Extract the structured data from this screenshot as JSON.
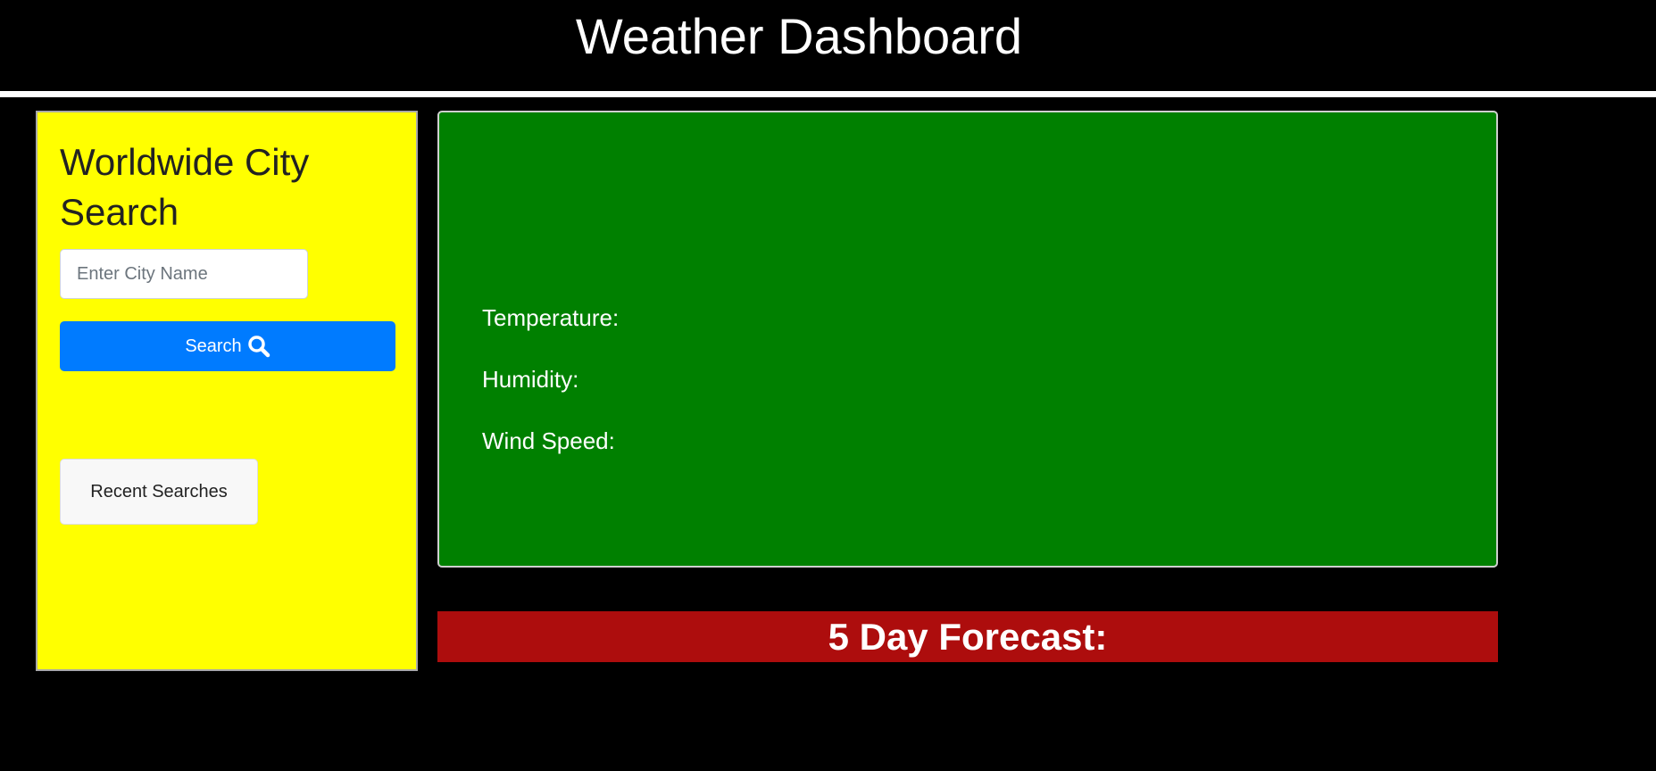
{
  "header": {
    "title": "Weather Dashboard"
  },
  "sidebar": {
    "title": "Worldwide City Search",
    "search_input": {
      "value": "",
      "placeholder": "Enter City Name"
    },
    "search_button_label": "Search",
    "recent_searches_label": "Recent Searches"
  },
  "current_weather": {
    "city": "",
    "temperature_label": "Temperature:",
    "humidity_label": "Humidity:",
    "wind_speed_label": "Wind Speed:"
  },
  "forecast": {
    "title": "5 Day Forecast:"
  },
  "colors": {
    "page_background": "#000000",
    "sidebar_background": "#ffff00",
    "current_card_background": "#008000",
    "search_button": "#007bff",
    "forecast_banner": "#ad0d0d"
  },
  "icons": {
    "search_button_icon": "search-icon"
  }
}
